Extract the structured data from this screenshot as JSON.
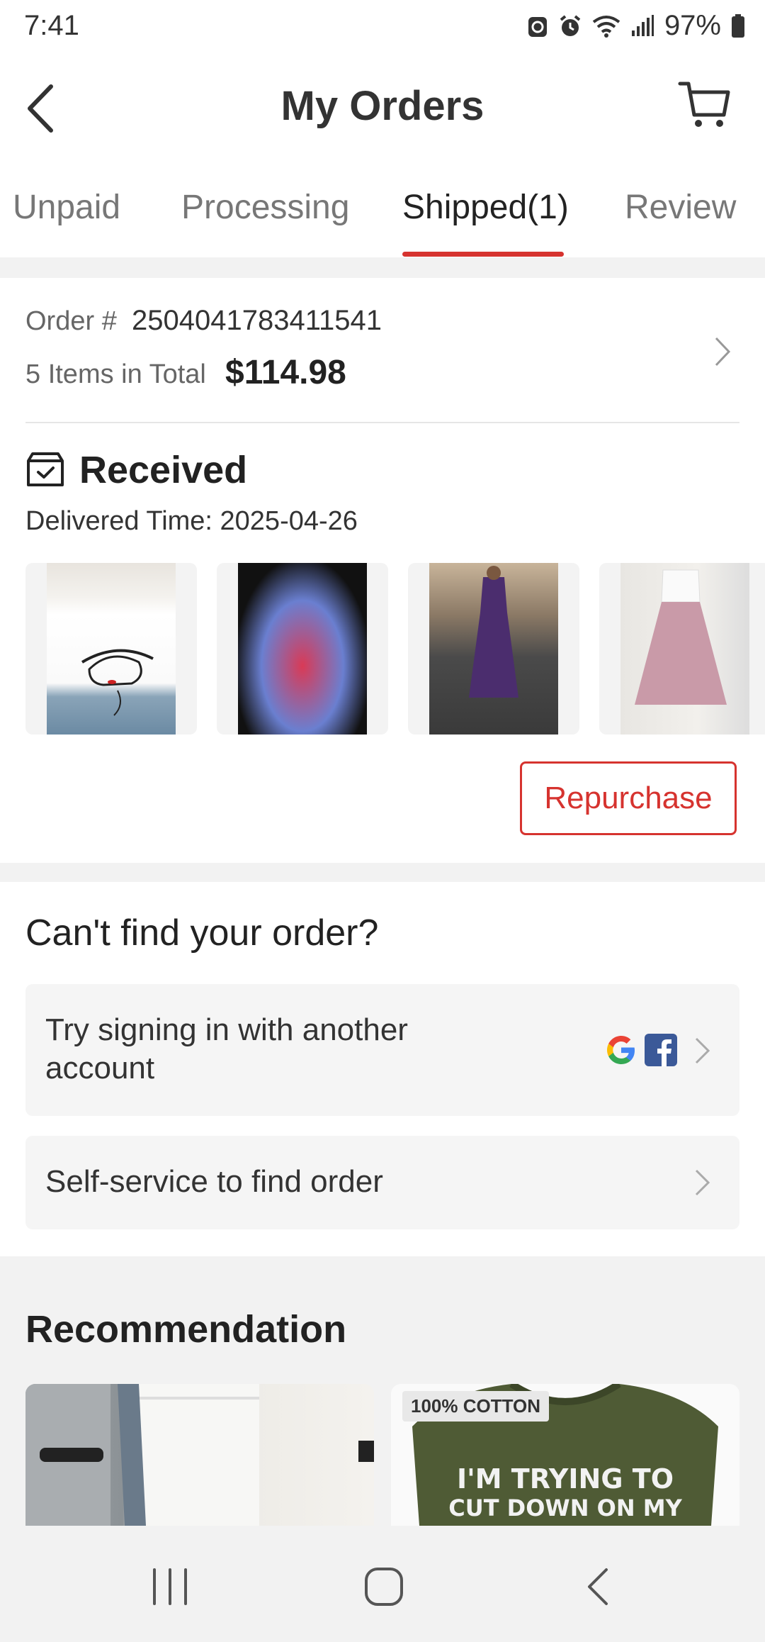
{
  "status_bar": {
    "time": "7:41",
    "battery": "97%",
    "icons": [
      "recycle-icon",
      "alarm-icon",
      "wifi-icon",
      "signal-icon",
      "battery-icon"
    ]
  },
  "header": {
    "title": "My Orders",
    "back_icon": "back-arrow-icon",
    "cart_icon": "cart-icon"
  },
  "tabs": [
    {
      "label": "Unpaid"
    },
    {
      "label": "Processing"
    },
    {
      "label": "Shipped(1)",
      "active": true
    },
    {
      "label": "Review"
    }
  ],
  "order": {
    "order_label": "Order #",
    "order_number": "2504041783411541",
    "items_label": "5 Items in Total",
    "total": "$114.98",
    "status": "Received",
    "delivered_time": "Delivered Time: 2025-04-26",
    "products": [
      {
        "name": "white-graphic-tshirt"
      },
      {
        "name": "red-floral-wrap-dress"
      },
      {
        "name": "purple-midi-dress"
      },
      {
        "name": "pink-a-line-skirt-outfit"
      }
    ],
    "repurchase_label": "Repurchase"
  },
  "find_order": {
    "title": "Can't find your order?",
    "sign_in_line1": "Try signing in with another",
    "sign_in_line2": "account",
    "self_service": "Self-service to find order"
  },
  "recommendation": {
    "title": "Recommendation",
    "items": [
      {
        "name": "white-wide-leg-pants"
      },
      {
        "name": "olive-tshirt",
        "badge": "100% COTTON",
        "line1": "I'M TRYING TO",
        "line2": "CUT DOWN ON MY"
      }
    ]
  },
  "colors": {
    "accent": "#d6332f",
    "page_bg": "#f2f2f2",
    "card_bg": "#ffffff"
  }
}
